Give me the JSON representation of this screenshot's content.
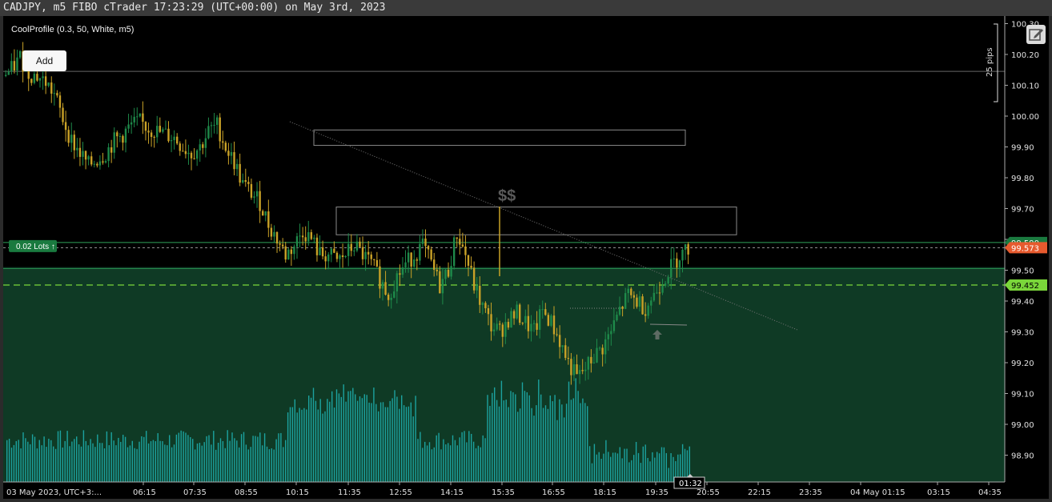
{
  "window": {
    "title": "CADJPY, m5 FIBO cTrader 17:23:29 (UTC+00:00) on May 3rd, 2023"
  },
  "indicator": {
    "label": "CoolProfile (0.3, 50, White, m5)"
  },
  "toolbar": {
    "add_label": "Add"
  },
  "ruler": {
    "label": "25 pips"
  },
  "annotation": {
    "dollar": "$$"
  },
  "position": {
    "lots_label": "0.02 Lots",
    "lots_label_back": "0.02 Lots"
  },
  "price_tags": {
    "top": "99.590",
    "current": "99.573",
    "entry": "99.452"
  },
  "time_cursor": "01:32",
  "colors": {
    "bull": "#1e8a4a",
    "bear": "#c9a227",
    "volume": "#1fb5b5",
    "zone": "#0f3a25",
    "entry_line": "#7ad63a",
    "current_tag": "#e65a2e",
    "position_tag": "#1a7a3f",
    "grid": "#3a3a3a"
  },
  "icons": [
    "edit-icon",
    "arrow-up-icon"
  ],
  "chart_data": {
    "type": "candlestick",
    "symbol": "CADJPY",
    "timeframe": "m5",
    "y_ticks": [
      "100.30",
      "100.20",
      "100.10",
      "100.00",
      "99.90",
      "99.80",
      "99.70",
      "99.60",
      "99.50",
      "99.40",
      "99.30",
      "99.20",
      "99.10",
      "99.00",
      "98.90"
    ],
    "y_tick_values": [
      100.3,
      100.2,
      100.1,
      100.0,
      99.9,
      99.8,
      99.7,
      99.6,
      99.5,
      99.4,
      99.3,
      99.2,
      99.1,
      99.0,
      98.9
    ],
    "ylim": [
      98.84,
      100.32
    ],
    "x_ticks": [
      "03 May 2023, UTC+3:...",
      "06:15",
      "07:35",
      "08:55",
      "10:15",
      "11:35",
      "12:55",
      "14:15",
      "15:35",
      "16:55",
      "18:15",
      "19:35",
      "20:55",
      "22:15",
      "23:35",
      "04 May 01:15",
      "03:15",
      "04:35"
    ],
    "close_path": [
      100.13,
      100.15,
      100.19,
      100.14,
      100.13,
      100.11,
      100.07,
      99.99,
      99.92,
      99.88,
      99.84,
      99.86,
      99.88,
      99.92,
      99.94,
      99.97,
      99.98,
      99.96,
      99.95,
      99.94,
      99.93,
      99.9,
      99.88,
      99.9,
      99.95,
      99.97,
      99.9,
      99.85,
      99.78,
      99.75,
      99.72,
      99.65,
      99.6,
      99.55,
      99.58,
      99.63,
      99.6,
      99.55,
      99.55,
      99.53,
      99.55,
      99.58,
      99.55,
      99.52,
      99.47,
      99.42,
      99.48,
      99.52,
      99.55,
      99.58,
      99.52,
      99.45,
      99.5,
      99.62,
      99.55,
      99.45,
      99.38,
      99.32,
      99.3,
      99.34,
      99.36,
      99.33,
      99.3,
      99.37,
      99.33,
      99.27,
      99.2,
      99.15,
      99.18,
      99.22,
      99.25,
      99.3,
      99.37,
      99.42,
      99.4,
      99.38,
      99.42,
      99.47,
      99.51,
      99.55,
      99.57
    ],
    "levels": {
      "upper_price": 99.59,
      "current_price": 99.573,
      "entry_price": 99.452,
      "zone_top": 99.51,
      "ruler_top": 100.3,
      "ruler_bottom": 100.04
    },
    "boxes": [
      {
        "from": 99.955,
        "to": 99.905
      },
      {
        "from": 99.705,
        "to": 99.615
      }
    ],
    "grid": false
  }
}
